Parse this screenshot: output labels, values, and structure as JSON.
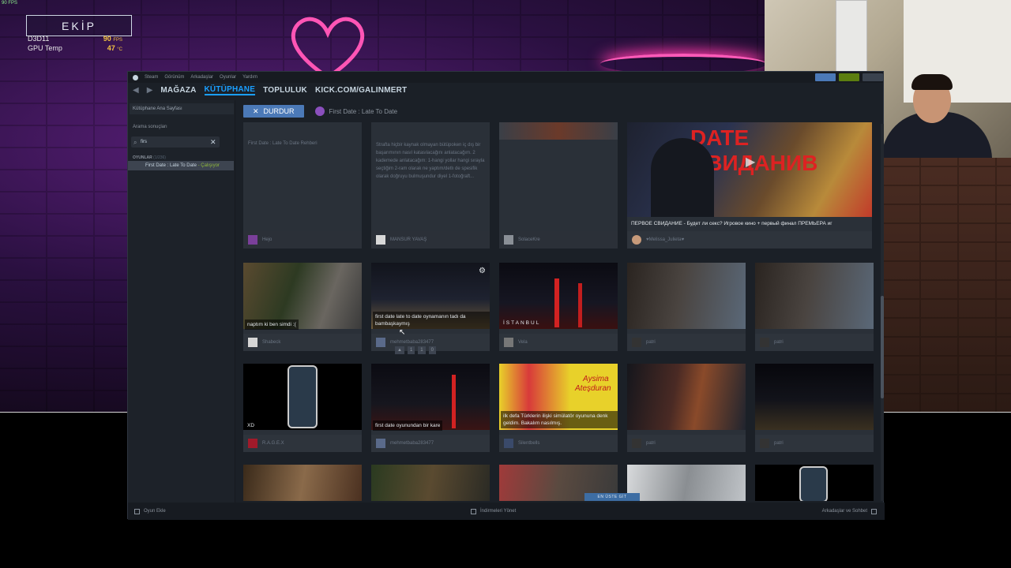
{
  "overlay": {
    "fps_top": "90 FPS",
    "team_label": "EKİP",
    "stat1": {
      "label": "D3D11",
      "value": "90",
      "unit": "FPS"
    },
    "stat2": {
      "label": "GPU Temp",
      "value": "47",
      "unit": "°C"
    }
  },
  "steam": {
    "titlebar": [
      "Steam",
      "Görünüm",
      "Arkadaşlar",
      "Oyunlar",
      "Yardım"
    ],
    "nav": {
      "store": "MAĞAZA",
      "library": "KÜTÜPHANE",
      "community": "TOPLULUK",
      "profile": "KICK.COM/GALINMERT"
    },
    "sidebar": {
      "home": "Kütüphane Ana Sayfası",
      "search_results": "Arama sonuçları",
      "search_value": "firs",
      "section": "OYUNLAR",
      "section_count": "(1/236)",
      "game": "First Date : Late To Date",
      "game_status": "- Çalışıyor"
    },
    "topbar": {
      "stop": "DURDUR",
      "game_title": "First Date : Late To Date"
    },
    "cards_row1": [
      {
        "text": "First Date : Late To Date Rehberi",
        "user": "Hejo"
      },
      {
        "text": "Strafta hiçbir kaynak olmayan bütüpoken iç dış bir başarımının nasıl katasılacağını anlatacağım. 2 kademede anlatacağım: 1-hangi yollar hangi sırayla seçtiğim 2-ram olarak ne yaptım/detlı de spesifik olarak doğruyu bulmuşundur diyel 1-fotoğraft...",
        "user": "MANSUR YAVAŞ"
      },
      {
        "text": "",
        "user": "SolaceKre"
      },
      {
        "text": "ПЕРВОЕ СВИДАНИЕ - Будет ли секс? Игровое кино + первый финал ПРЕМЬЕРА иг",
        "user": "♥Melissa_Julieta♥"
      }
    ],
    "cards_row2": [
      {
        "caption": "naptım ki ben simdi :(",
        "user": "Shabeck"
      },
      {
        "caption": "first date late to date oynamanın tadı da bambaşkaymış",
        "user": "mehmetbaba283477"
      },
      {
        "caption": "İSTANBUL",
        "user": "Vela"
      },
      {
        "caption": "",
        "user": "patri"
      },
      {
        "caption": "",
        "user": "patri"
      }
    ],
    "cards_row3": [
      {
        "caption": "XD",
        "user": "R.A.G.E.X"
      },
      {
        "caption": "first date oyunundan bir kare",
        "user": "mehmetbaba283477"
      },
      {
        "caption": "ilk defa Türklerin ilişki simülatör oyununa denk geldim. Bakalım nasılmış.",
        "user": "Silentbells",
        "overlay1": "Aysima",
        "overlay2": "Ateşduran"
      },
      {
        "caption": "",
        "user": "patri"
      },
      {
        "caption": "",
        "user": "patri"
      }
    ],
    "card_actions": [
      "1",
      "1",
      "0"
    ],
    "scroll_top": "EN ÜSTE GİT",
    "status": {
      "add_game": "Oyun Ekle",
      "downloads": "İndirmeleri Yönet",
      "friends": "Arkadaşlar ve Sohbet"
    },
    "thumbnail_title": "DATE СВИДАНИВ"
  },
  "colors": {
    "accent": "#1a9fff",
    "button": "#4b79b7",
    "playing": "#90ba3c"
  }
}
